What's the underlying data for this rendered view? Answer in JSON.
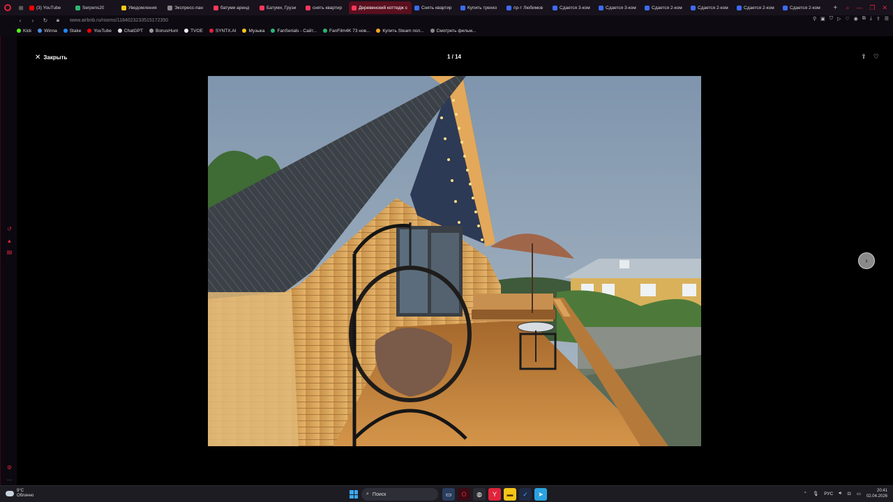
{
  "browser": {
    "tabs": [
      {
        "label": "(3) YouTube",
        "color": "#ff0000"
      },
      {
        "label": "Serpens20",
        "color": "#2bb673"
      },
      {
        "label": "Уведомления",
        "color": "#f5c518"
      },
      {
        "label": "Экспресс-пан",
        "color": "#888888"
      },
      {
        "label": "батуми аренд",
        "color": "#ff385c"
      },
      {
        "label": "Батуми, Грузи",
        "color": "#ff385c"
      },
      {
        "label": "снять квартир",
        "color": "#ff385c"
      },
      {
        "label": "Деревенский коттедж с",
        "color": "#ff385c",
        "active": true
      },
      {
        "label": "Снять квартир",
        "color": "#3b6cf6"
      },
      {
        "label": "Купить трехко",
        "color": "#3b6cf6"
      },
      {
        "label": "пр-т Любимов",
        "color": "#3b6cf6"
      },
      {
        "label": "Сдается 3-ком",
        "color": "#3b6cf6"
      },
      {
        "label": "Сдается 3-ком",
        "color": "#3b6cf6"
      },
      {
        "label": "Сдается 2-ком",
        "color": "#3b6cf6"
      },
      {
        "label": "Сдается 2-ком",
        "color": "#3b6cf6"
      },
      {
        "label": "Сдается 2-ком",
        "color": "#3b6cf6"
      },
      {
        "label": "Сдается 2-ком",
        "color": "#3b6cf6"
      }
    ],
    "url": "www.airbnb.ru/rooms/1184023233515172350",
    "bookmarks": [
      {
        "label": "Kick",
        "color": "#53fc18"
      },
      {
        "label": "Winna",
        "color": "#4a90e2"
      },
      {
        "label": "Stake",
        "color": "#1f8cff"
      },
      {
        "label": "YouTube",
        "color": "#ff0000"
      },
      {
        "label": "ChatGPT",
        "color": "#dddddd"
      },
      {
        "label": "BonusHunt",
        "color": "#999999"
      },
      {
        "label": "TVOE",
        "color": "#eeeeee"
      },
      {
        "label": "SYNTX.AI",
        "color": "#e0243a"
      },
      {
        "label": "Музыка",
        "color": "#f5c518"
      },
      {
        "label": "FanSerials - Сайт...",
        "color": "#2bb673"
      },
      {
        "label": "FanFilm4K 73 нов...",
        "color": "#2bb673"
      },
      {
        "label": "Купить Steam пол...",
        "color": "#f5a623"
      },
      {
        "label": "Смотреть фильм...",
        "color": "#888888"
      }
    ]
  },
  "viewer": {
    "close_label": "Закрыть",
    "counter": "1 / 14"
  },
  "taskbar": {
    "weather_temp": "9°C",
    "weather_desc": "Облачно",
    "search_placeholder": "Поиск",
    "lang": "РУС",
    "time": "20:41",
    "date": "02.04.2026"
  }
}
